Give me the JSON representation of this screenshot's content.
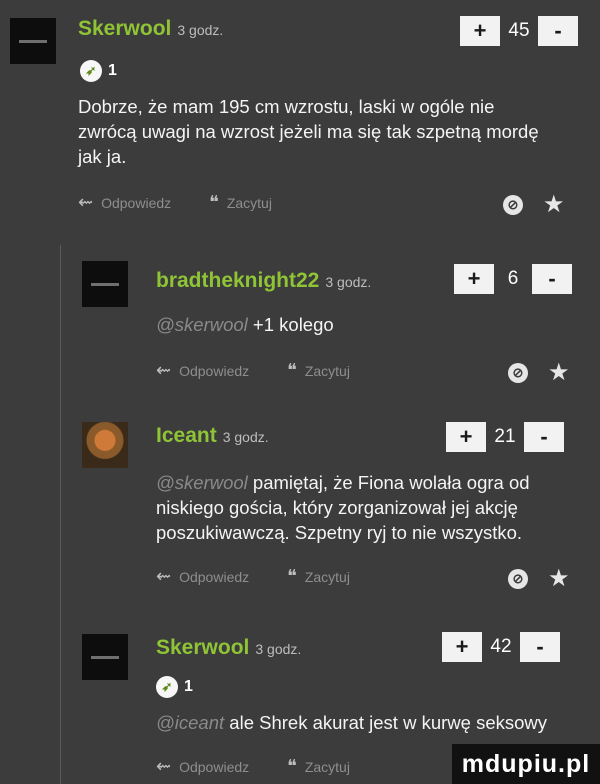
{
  "comments": [
    {
      "username": "Skerwool",
      "time": "3 godz.",
      "vote_plus": "+",
      "vote_count": "45",
      "vote_minus": "-",
      "badge_count": "1",
      "mention": "",
      "text": "Dobrze, że mam 195 cm wzrostu, laski w ogóle nie zwrócą uwagi na wzrost jeżeli ma się tak szpetną mordę jak ja.",
      "reply_label": "Odpowiedz",
      "quote_label": "Zacytuj"
    },
    {
      "username": "bradtheknight22",
      "time": "3 godz.",
      "vote_plus": "+",
      "vote_count": "6",
      "vote_minus": "-",
      "mention": "@skerwool",
      "text": "+1 kolego",
      "reply_label": "Odpowiedz",
      "quote_label": "Zacytuj"
    },
    {
      "username": "Iceant",
      "time": "3 godz.",
      "vote_plus": "+",
      "vote_count": "21",
      "vote_minus": "-",
      "mention": "@skerwool",
      "text": "pamiętaj, że Fiona wolała ogra od niskiego gościa, który zorganizował jej akcję poszukiwawczą. Szpetny ryj to nie wszystko.",
      "reply_label": "Odpowiedz",
      "quote_label": "Zacytuj"
    },
    {
      "username": "Skerwool",
      "time": "3 godz.",
      "vote_plus": "+",
      "vote_count": "42",
      "vote_minus": "-",
      "badge_count": "1",
      "mention": "@iceant",
      "text": "ale Shrek akurat jest w kurwę seksowy",
      "reply_label": "Odpowiedz",
      "quote_label": "Zacytuj"
    }
  ],
  "watermark": "mdupiu.pl",
  "icons": {
    "reply": "reply-arrow-icon",
    "quote": "quote-icon",
    "flag": "flag-icon",
    "star": "star-icon",
    "badge": "rocket-badge-icon"
  },
  "colors": {
    "background": "#3c3c3c",
    "username": "#8fc436",
    "text": "#f4f4f4",
    "muted": "#8e8e8e"
  }
}
